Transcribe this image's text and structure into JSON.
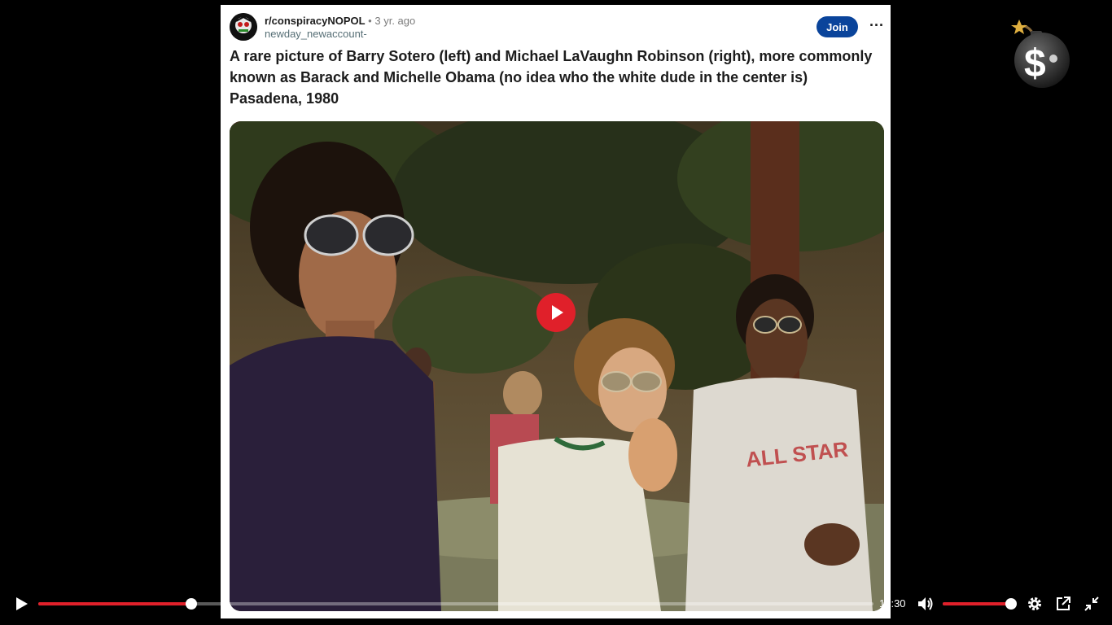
{
  "post": {
    "subreddit": "r/conspiracyNOPOL",
    "separator": "•",
    "age": "3 yr. ago",
    "username": "newday_newaccount-",
    "join_label": "Join",
    "more_label": "···",
    "title": "A rare picture of Barry Sotero (left) and Michael LaVaughn Robinson (right), more commonly known as Barack and Michelle Obama (no idea who the white dude in the center is) Pasadena, 1980",
    "photo_shirt_text": "ALL STAR"
  },
  "player": {
    "time": "10:30",
    "progress": 0.183,
    "volume": 1.0,
    "accent_color": "#e0202a",
    "icons": {
      "play": "play-icon",
      "center_play": "play-circle-icon",
      "volume": "volume-icon",
      "settings": "gear-icon",
      "popout": "external-link-icon",
      "fullscreen_exit": "exit-fullscreen-icon"
    }
  },
  "overlay": {
    "logo_symbol": "$"
  }
}
